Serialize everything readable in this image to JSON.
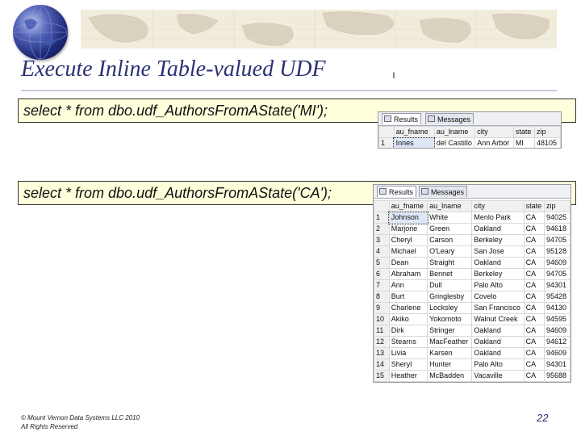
{
  "slide": {
    "title": "Execute Inline Table-valued UDF",
    "bullet_mark": "ı",
    "queries": [
      "select * from dbo.udf_AuthorsFromAState('MI');",
      "select * from dbo.udf_AuthorsFromAState('CA');"
    ],
    "footer_line1": "© Mount Vernon Data Systems LLC 2010",
    "footer_line2": "All Rights Reserved",
    "page_number": "22"
  },
  "colors": {
    "title": "#2b3173",
    "query_bg": "#ffffdc",
    "banner_bg": "#f2ecdc"
  },
  "icons": {
    "globe": "globe-icon",
    "results_tab": "grid-icon",
    "messages_tab": "messages-icon"
  },
  "results_mi": {
    "tabs": [
      "Results",
      "Messages"
    ],
    "columns": [
      "au_fname",
      "au_lname",
      "city",
      "state",
      "zip"
    ],
    "rows": [
      [
        "1",
        "Innes",
        "del Castillo",
        "Ann Arbor",
        "MI",
        "48105"
      ]
    ]
  },
  "results_ca": {
    "tabs": [
      "Results",
      "Messages"
    ],
    "columns": [
      "au_fname",
      "au_lname",
      "city",
      "state",
      "zip"
    ],
    "rows": [
      [
        "1",
        "Johnson",
        "White",
        "Menlo Park",
        "CA",
        "94025"
      ],
      [
        "2",
        "Marjorie",
        "Green",
        "Oakland",
        "CA",
        "94618"
      ],
      [
        "3",
        "Cheryl",
        "Carson",
        "Berkeley",
        "CA",
        "94705"
      ],
      [
        "4",
        "Michael",
        "O'Leary",
        "San Jose",
        "CA",
        "95128"
      ],
      [
        "5",
        "Dean",
        "Straight",
        "Oakland",
        "CA",
        "94609"
      ],
      [
        "6",
        "Abraham",
        "Bennet",
        "Berkeley",
        "CA",
        "94705"
      ],
      [
        "7",
        "Ann",
        "Dull",
        "Palo Alto",
        "CA",
        "94301"
      ],
      [
        "8",
        "Burt",
        "Gringlesby",
        "Covelo",
        "CA",
        "95428"
      ],
      [
        "9",
        "Charlene",
        "Locksley",
        "San Francisco",
        "CA",
        "94130"
      ],
      [
        "10",
        "Akiko",
        "Yokomoto",
        "Walnut Creek",
        "CA",
        "94595"
      ],
      [
        "11",
        "Dirk",
        "Stringer",
        "Oakland",
        "CA",
        "94609"
      ],
      [
        "12",
        "Stearns",
        "MacFeather",
        "Oakland",
        "CA",
        "94612"
      ],
      [
        "13",
        "Livia",
        "Karsen",
        "Oakland",
        "CA",
        "94609"
      ],
      [
        "14",
        "Sheryl",
        "Hunter",
        "Palo Alto",
        "CA",
        "94301"
      ],
      [
        "15",
        "Heather",
        "McBadden",
        "Vacaville",
        "CA",
        "95688"
      ]
    ]
  }
}
